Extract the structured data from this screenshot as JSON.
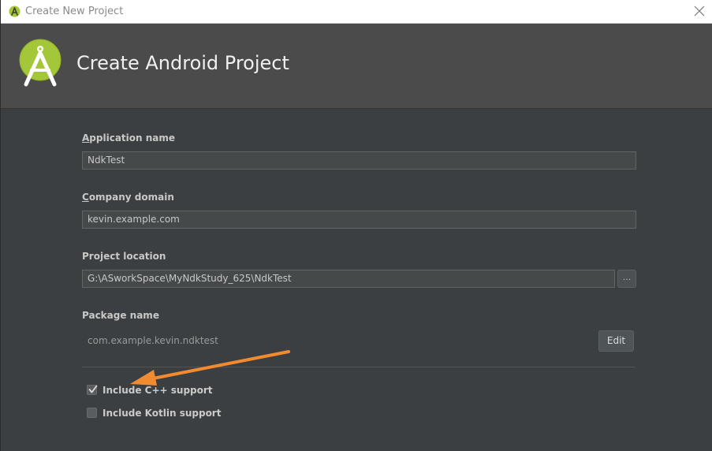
{
  "window": {
    "title": "Create New Project"
  },
  "header": {
    "title": "Create Android Project"
  },
  "form": {
    "application_name": {
      "label_mnemonic": "A",
      "label_rest": "pplication name",
      "value": "NdkTest"
    },
    "company_domain": {
      "label_mnemonic": "C",
      "label_rest": "ompany domain",
      "value": "kevin.example.com"
    },
    "project_location": {
      "label": "Project location",
      "value": "G:\\ASworkSpace\\MyNdkStudy_625\\NdkTest",
      "browse_label": "..."
    },
    "package_name": {
      "label": "Package name",
      "value": "com.example.kevin.ndktest",
      "edit_label": "Edit"
    }
  },
  "options": {
    "include_cpp": {
      "label": "Include C++ support",
      "checked": true
    },
    "include_kotlin": {
      "label": "Include Kotlin support",
      "checked": false
    }
  },
  "colors": {
    "header_bg": "#4b4b4b",
    "body_bg": "#3c3f41",
    "android_green": "#a4c639",
    "annotation_arrow": "#f28b30"
  },
  "icons": {
    "app": "android-studio-icon",
    "logo": "android-studio-logo",
    "close": "close-icon",
    "check": "checkmark-icon"
  }
}
